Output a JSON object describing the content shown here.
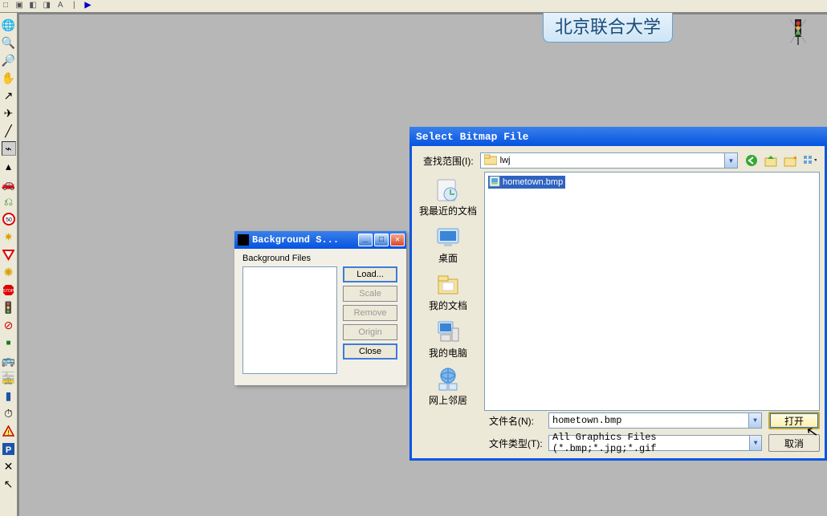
{
  "org_label": "北京联合大学",
  "bg_dialog": {
    "title": "Background S...",
    "section_label": "Background Files",
    "buttons": {
      "load": "Load...",
      "scale": "Scale",
      "remove": "Remove",
      "origin": "Origin",
      "close": "Close"
    }
  },
  "file_dialog": {
    "title": "Select Bitmap File",
    "look_in_label": "查找范围(I):",
    "look_in_value": "lwj",
    "places": {
      "recent": "我最近的文档",
      "desktop": "桌面",
      "mydocs": "我的文档",
      "mypc": "我的电脑",
      "network": "网上邻居"
    },
    "file_selected": "hometown.bmp",
    "fn_label": "文件名(N):",
    "fn_value": "hometown.bmp",
    "ft_label": "文件类型(T):",
    "ft_value": "All Graphics Files (*.bmp;*.jpg;*.gif",
    "open_btn": "打开",
    "cancel_btn": "取消"
  }
}
